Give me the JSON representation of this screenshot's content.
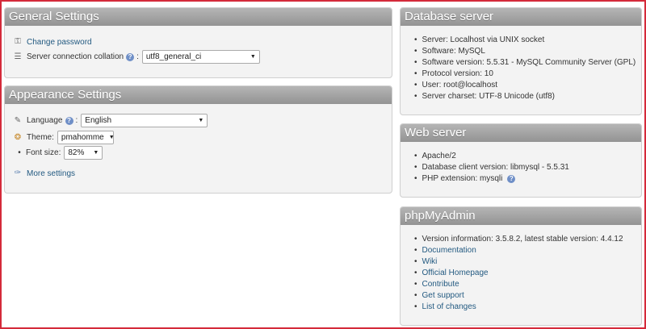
{
  "general": {
    "title": "General Settings",
    "change_password": "Change password",
    "collation_label": "Server connection collation",
    "collation_value": "utf8_general_ci"
  },
  "appearance": {
    "title": "Appearance Settings",
    "language_label": "Language",
    "language_value": "English",
    "theme_label": "Theme:",
    "theme_value": "pmahomme",
    "fontsize_label": "Font size:",
    "fontsize_value": "82%",
    "more_settings": "More settings"
  },
  "database": {
    "title": "Database server",
    "items": [
      "Server: Localhost via UNIX socket",
      "Software: MySQL",
      "Software version: 5.5.31 - MySQL Community Server (GPL)",
      "Protocol version: 10",
      "User: root@localhost",
      "Server charset: UTF-8 Unicode (utf8)"
    ]
  },
  "web": {
    "title": "Web server",
    "items": [
      "Apache/2",
      "Database client version: libmysql - 5.5.31",
      "PHP extension: mysqli"
    ]
  },
  "pma": {
    "title": "phpMyAdmin",
    "version": "Version information: 3.5.8.2, latest stable version: 4.4.12",
    "links": [
      "Documentation",
      "Wiki",
      "Official Homepage",
      "Contribute",
      "Get support",
      "List of changes"
    ]
  },
  "icons": {
    "help": "help-icon",
    "colors": {
      "frame": "#d42a3a",
      "link": "#235a81",
      "header": "#a4a4a4"
    }
  }
}
